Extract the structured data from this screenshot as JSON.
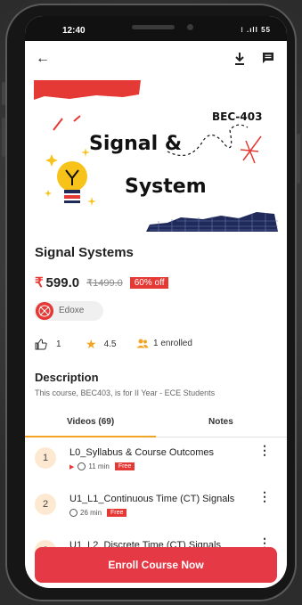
{
  "status_bar": {
    "time": "12:40",
    "icons": "⁝ .ıll 55"
  },
  "course": {
    "banner_title_line1": "Signal &",
    "banner_title_line2": "System",
    "banner_code": "BEC-403",
    "title": "Signal Systems",
    "currency": "₹",
    "price": "599.0",
    "old_price": "₹1499.0",
    "discount": "60% off",
    "provider": "Edoxe",
    "likes": "1",
    "rating": "4.5",
    "enrolled": "1 enrolled"
  },
  "description": {
    "heading": "Description",
    "text": "This course, BEC403, is for II Year - ECE Students"
  },
  "tabs": [
    {
      "label": "Videos (69)",
      "active": true
    },
    {
      "label": "Notes",
      "active": false
    }
  ],
  "videos": [
    {
      "index": "1",
      "title": "L0_Syllabus & Course Outcomes",
      "duration": "11 min",
      "badge": "Free"
    },
    {
      "index": "2",
      "title": "U1_L1_Continuous Time (CT) Signals",
      "duration": "26 min",
      "badge": "Free"
    },
    {
      "index": "3",
      "title": "U1_L2_Discrete Time (CT) Signals",
      "duration": "",
      "badge": ""
    }
  ],
  "cta": {
    "label": "Enroll Course Now"
  },
  "colors": {
    "accent": "#e53935",
    "tab_indicator": "#f4a423",
    "banner_grid": "#1f2a5a"
  }
}
